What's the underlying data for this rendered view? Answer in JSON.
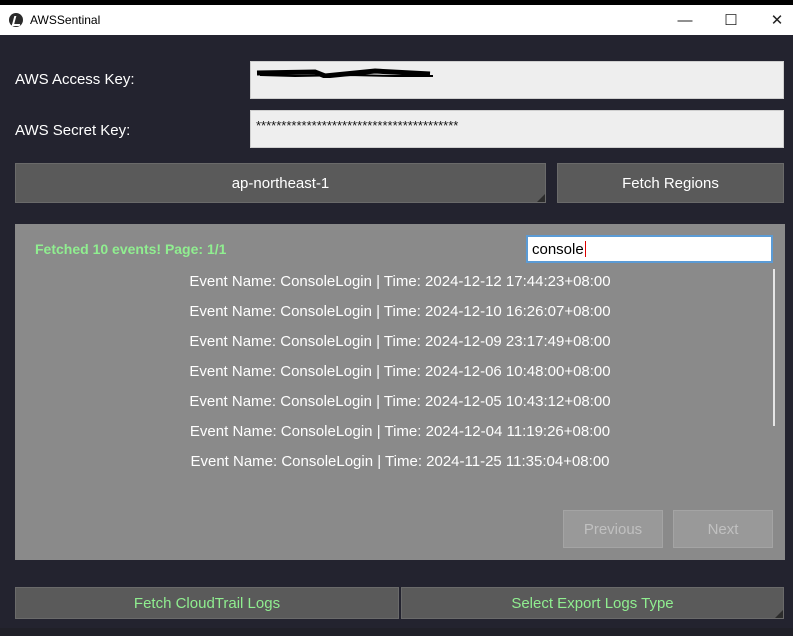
{
  "window": {
    "title": "AWSSentinal",
    "minimize_glyph": "—",
    "maximize_glyph": "☐",
    "close_glyph": "✕"
  },
  "form": {
    "access_key_label": "AWS Access Key:",
    "access_key_value": "",
    "secret_key_label": "AWS Secret Key:",
    "secret_key_value": "****************************************",
    "region_selected": "ap-northeast-1",
    "fetch_regions_label": "Fetch Regions"
  },
  "results": {
    "status_text": "Fetched 10 events! Page: 1/1",
    "search_value": "console",
    "events": [
      "Event Name: ConsoleLogin | Time: 2024-12-12 17:44:23+08:00",
      "Event Name: ConsoleLogin | Time: 2024-12-10 16:26:07+08:00",
      "Event Name: ConsoleLogin | Time: 2024-12-09 23:17:49+08:00",
      "Event Name: ConsoleLogin | Time: 2024-12-06 10:48:00+08:00",
      "Event Name: ConsoleLogin | Time: 2024-12-05 10:43:12+08:00",
      "Event Name: ConsoleLogin | Time: 2024-12-04 11:19:26+08:00",
      "Event Name: ConsoleLogin | Time: 2024-11-25 11:35:04+08:00"
    ],
    "previous_label": "Previous",
    "next_label": "Next"
  },
  "footer": {
    "fetch_logs_label": "Fetch CloudTrail Logs",
    "export_type_label": "Select Export Logs Type"
  },
  "colors": {
    "background": "#23232f",
    "panel": "#8a8a8a",
    "button": "#5a5a5a",
    "status_green": "#90ee90"
  }
}
